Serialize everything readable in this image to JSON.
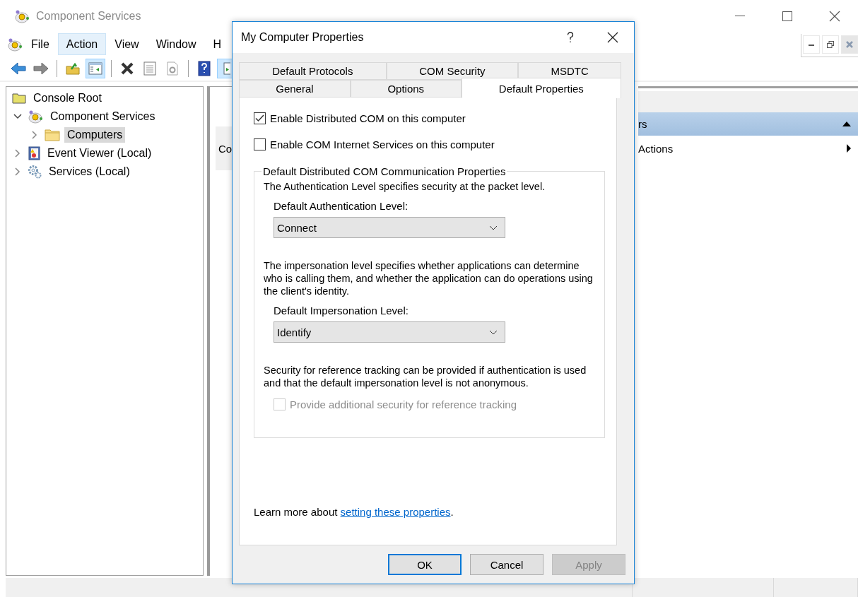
{
  "window": {
    "title": "Component Services"
  },
  "menu": [
    {
      "label": "File",
      "selected": false
    },
    {
      "label": "Action",
      "selected": true
    },
    {
      "label": "View",
      "selected": false
    },
    {
      "label": "Window",
      "selected": false
    },
    {
      "label": "H",
      "selected": false
    }
  ],
  "toolbar_groups": [
    [
      {
        "kind": "back",
        "pressed": false
      },
      {
        "kind": "forward",
        "pressed": false
      }
    ],
    [
      {
        "kind": "up",
        "pressed": false
      },
      {
        "kind": "tree",
        "pressed": true
      }
    ],
    [
      {
        "kind": "delete",
        "pressed": false
      },
      {
        "kind": "properties",
        "pressed": false
      },
      {
        "kind": "refresh",
        "pressed": false
      }
    ],
    [
      {
        "kind": "help",
        "pressed": false
      },
      {
        "kind": "pane",
        "pressed": true
      }
    ]
  ],
  "tree": [
    {
      "label": "Console Root",
      "kind": "root",
      "children": [
        {
          "label": "Component Services",
          "kind": "component",
          "expanded": true,
          "selected": false,
          "children": [
            {
              "label": "Computers",
              "kind": "folder",
              "expanded": false,
              "selected": true
            }
          ]
        },
        {
          "label": "Event Viewer (Local)",
          "kind": "event",
          "expanded": false,
          "selected": false
        },
        {
          "label": "Services (Local)",
          "kind": "services",
          "expanded": false,
          "selected": false
        }
      ]
    }
  ],
  "middle_panel": {
    "text": "Co"
  },
  "actions_panel": {
    "header": "rs",
    "items": [
      {
        "label": "Actions"
      }
    ]
  },
  "dialog": {
    "title": "My Computer Properties",
    "tab_rows": [
      [
        {
          "label": "Default Protocols",
          "selected": false
        },
        {
          "label": "COM Security",
          "selected": false
        },
        {
          "label": "MSDTC",
          "selected": false
        }
      ],
      [
        {
          "label": "General",
          "selected": false
        },
        {
          "label": "Options",
          "selected": false
        },
        {
          "label": "Default Properties",
          "selected": true
        }
      ]
    ],
    "checkboxes": [
      {
        "label": "Enable Distributed COM on this computer",
        "checked": true
      },
      {
        "label": "Enable COM Internet Services on this computer",
        "checked": false
      }
    ],
    "group": {
      "legend": "Default Distributed COM Communication Properties",
      "items": [
        {
          "kind": "text",
          "text": "The Authentication Level specifies security at the packet level."
        },
        {
          "kind": "select",
          "label": "Default Authentication Level:",
          "value": "Connect"
        },
        {
          "kind": "text",
          "text": "The impersonation level specifies whether applications can determine who is calling them, and whether the application can do operations using the client's identity."
        },
        {
          "kind": "select",
          "label": "Default Impersonation Level:",
          "value": "Identify"
        },
        {
          "kind": "text",
          "text": "Security for reference tracking can be provided if authentication is used and that the default impersonation level is not anonymous."
        },
        {
          "kind": "checkbox",
          "label": "Provide additional security for reference tracking",
          "checked": false,
          "disabled": true
        }
      ]
    },
    "footer": {
      "before": "Learn more about",
      "link": "setting these properties",
      "after": "."
    },
    "buttons": [
      {
        "label": "OK",
        "default": true,
        "disabled": false
      },
      {
        "label": "Cancel",
        "default": false,
        "disabled": false
      },
      {
        "label": "Apply",
        "default": false,
        "disabled": true
      }
    ]
  }
}
